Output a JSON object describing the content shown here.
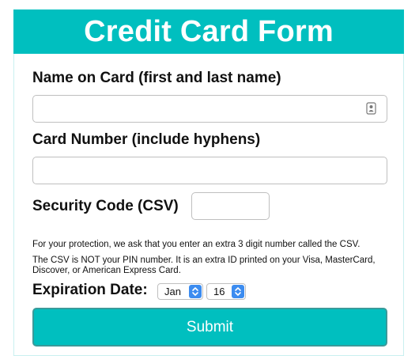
{
  "header": {
    "title": "Credit Card Form"
  },
  "name_field": {
    "label": "Name on Card (first and last name)",
    "value": "",
    "placeholder": ""
  },
  "card_field": {
    "label": "Card Number (include hyphens)",
    "value": "",
    "placeholder": ""
  },
  "csv_field": {
    "label": "Security Code (CSV)",
    "value": "",
    "placeholder": ""
  },
  "help_text": {
    "line1": "For your protection, we ask that you enter an extra 3 digit number called the CSV.",
    "line2": "The CSV is NOT your PIN number. It is an extra ID printed on your Visa, MasterCard,",
    "line3": "Discover, or American Express Card."
  },
  "expiration": {
    "label": "Expiration Date:",
    "month": "Jan",
    "day": "16"
  },
  "submit": {
    "label": "Submit"
  },
  "colors": {
    "accent": "#00bfbf",
    "select_accent": "#3c8cf0"
  },
  "icons": {
    "name_autofill": "contact-card-icon",
    "select_arrows": "chevron-updown-icon"
  }
}
